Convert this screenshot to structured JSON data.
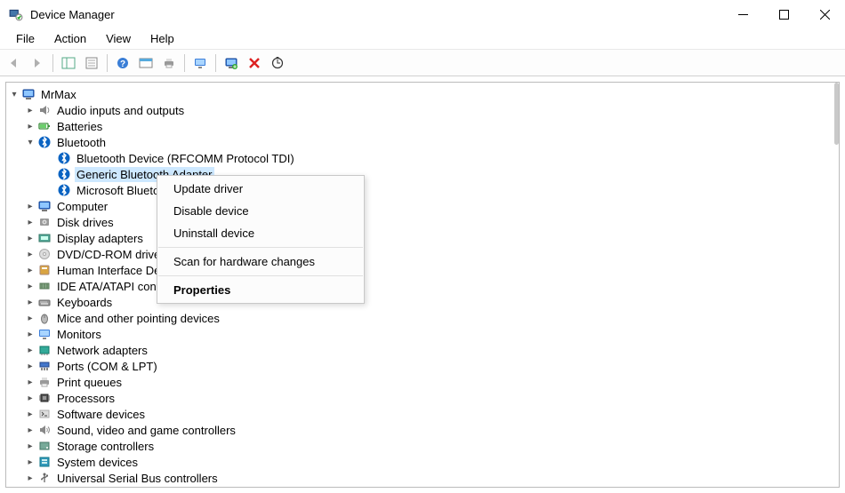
{
  "window": {
    "title": "Device Manager"
  },
  "menu": {
    "file": "File",
    "action": "Action",
    "view": "View",
    "help": "Help"
  },
  "toolbar_icons": {
    "back": "back-arrow-icon",
    "forward": "forward-arrow-icon",
    "show_hide": "show-hide-console-tree-icon",
    "properties_sheet": "properties-sheet-icon",
    "help": "help-icon",
    "action_log": "action-log-icon",
    "print": "print-icon",
    "monitor": "monitor-icon",
    "add_hardware": "add-legacy-hardware-icon",
    "remove": "remove-icon",
    "scan": "scan-hardware-icon"
  },
  "root": {
    "label": "MrMax"
  },
  "categories": [
    {
      "label": "Audio inputs and outputs",
      "icon": "audio-icon",
      "expanded": false
    },
    {
      "label": "Batteries",
      "icon": "battery-icon",
      "expanded": false
    },
    {
      "label": "Bluetooth",
      "icon": "bluetooth-icon",
      "expanded": true,
      "children": [
        {
          "label": "Bluetooth Device (RFCOMM Protocol TDI)",
          "icon": "bluetooth-icon"
        },
        {
          "label": "Generic Bluetooth Adapter",
          "icon": "bluetooth-icon",
          "selected": true
        },
        {
          "label": "Microsoft Bluetoo",
          "icon": "bluetooth-icon",
          "truncated": true
        }
      ]
    },
    {
      "label": "Computer",
      "icon": "computer-icon",
      "expanded": false
    },
    {
      "label": "Disk drives",
      "icon": "disk-icon",
      "expanded": false
    },
    {
      "label": "Display adapters",
      "icon": "display-adapter-icon",
      "expanded": false
    },
    {
      "label": "DVD/CD-ROM drives",
      "icon": "dvd-icon",
      "expanded": false
    },
    {
      "label": "Human Interface Dev",
      "icon": "hid-icon",
      "expanded": false,
      "truncated": true
    },
    {
      "label": "IDE ATA/ATAPI contro",
      "icon": "ide-icon",
      "expanded": false,
      "truncated": true
    },
    {
      "label": "Keyboards",
      "icon": "keyboard-icon",
      "expanded": false
    },
    {
      "label": "Mice and other pointing devices",
      "icon": "mouse-icon",
      "expanded": false
    },
    {
      "label": "Monitors",
      "icon": "monitor-icon",
      "expanded": false
    },
    {
      "label": "Network adapters",
      "icon": "network-adapter-icon",
      "expanded": false
    },
    {
      "label": "Ports (COM & LPT)",
      "icon": "ports-icon",
      "expanded": false
    },
    {
      "label": "Print queues",
      "icon": "print-queue-icon",
      "expanded": false
    },
    {
      "label": "Processors",
      "icon": "processor-icon",
      "expanded": false
    },
    {
      "label": "Software devices",
      "icon": "software-device-icon",
      "expanded": false
    },
    {
      "label": "Sound, video and game controllers",
      "icon": "sound-icon",
      "expanded": false
    },
    {
      "label": "Storage controllers",
      "icon": "storage-controller-icon",
      "expanded": false
    },
    {
      "label": "System devices",
      "icon": "system-device-icon",
      "expanded": false
    },
    {
      "label": "Universal Serial Bus controllers",
      "icon": "usb-icon",
      "expanded": false
    }
  ],
  "context_menu": {
    "update": "Update driver",
    "disable": "Disable device",
    "uninstall": "Uninstall device",
    "scan": "Scan for hardware changes",
    "properties": "Properties"
  }
}
